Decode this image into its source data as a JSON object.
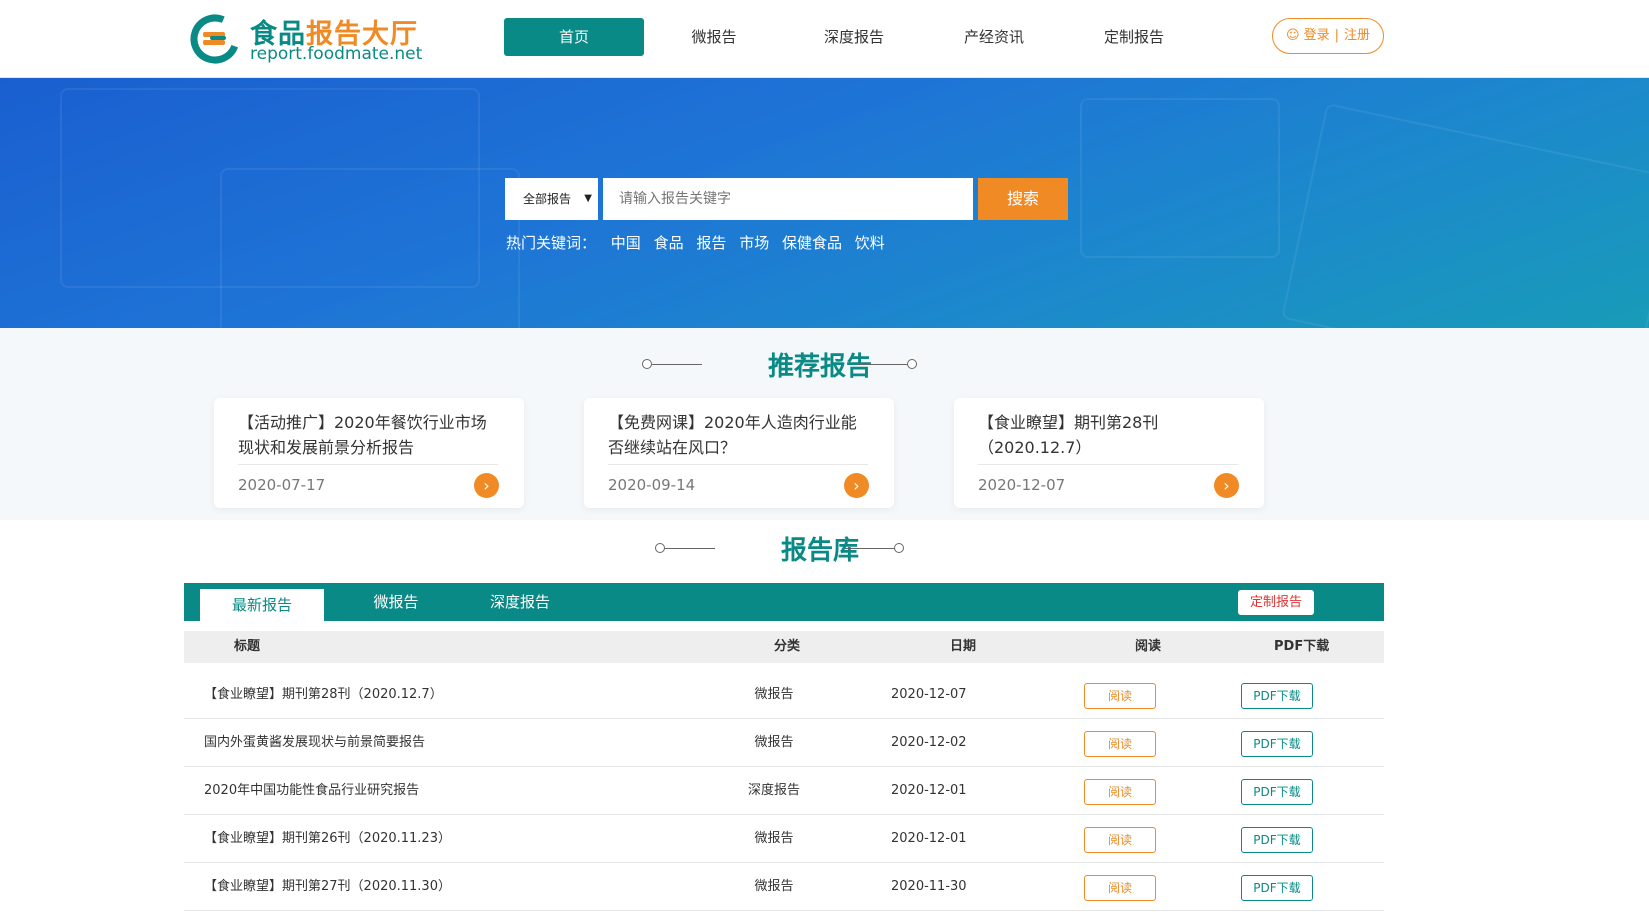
{
  "header": {
    "logo_title_part1": "食品",
    "logo_title_part2": "报告大厅",
    "logo_url": "report.foodmate.net",
    "nav": [
      {
        "label": "首页",
        "active": true
      },
      {
        "label": "微报告",
        "active": false
      },
      {
        "label": "深度报告",
        "active": false
      },
      {
        "label": "产经资讯",
        "active": false
      },
      {
        "label": "定制报告",
        "active": false
      }
    ],
    "login_label": "登录",
    "register_label": "注册"
  },
  "search": {
    "scope_label": "全部报告",
    "placeholder": "请输入报告关键字",
    "button_label": "搜索",
    "hot_label": "热门关键词：",
    "hot_keywords": [
      "中国",
      "食品",
      "报告",
      "市场",
      "保健食品",
      "饮料"
    ]
  },
  "recommend": {
    "title": "推荐报告",
    "cards": [
      {
        "title": "【活动推广】2020年餐饮行业市场现状和发展前景分析报告",
        "date": "2020-07-17"
      },
      {
        "title": "【免费网课】2020年人造肉行业能否继续站在风口？",
        "date": "2020-09-14"
      },
      {
        "title": "【食业瞭望】期刊第28刊（2020.12.7）",
        "date": "2020-12-07"
      }
    ]
  },
  "library": {
    "title": "报告库",
    "tabs": [
      {
        "label": "最新报告",
        "active": true
      },
      {
        "label": "微报告",
        "active": false
      },
      {
        "label": "深度报告",
        "active": false
      }
    ],
    "custom_button": "定制报告",
    "columns": {
      "title": "标题",
      "category": "分类",
      "date": "日期",
      "read": "阅读",
      "pdf": "PDF下载"
    },
    "rows": [
      {
        "title": "【食业瞭望】期刊第28刊（2020.12.7）",
        "category": "微报告",
        "date": "2020-12-07",
        "read": "阅读",
        "pdf": "PDF下载"
      },
      {
        "title": "国内外蛋黄酱发展现状与前景简要报告",
        "category": "微报告",
        "date": "2020-12-02",
        "read": "阅读",
        "pdf": "PDF下载"
      },
      {
        "title": "2020年中国功能性食品行业研究报告",
        "category": "深度报告",
        "date": "2020-12-01",
        "read": "阅读",
        "pdf": "PDF下载"
      },
      {
        "title": "【食业瞭望】期刊第26刊（2020.11.23）",
        "category": "微报告",
        "date": "2020-12-01",
        "read": "阅读",
        "pdf": "PDF下载"
      },
      {
        "title": "【食业瞭望】期刊第27刊（2020.11.30）",
        "category": "微报告",
        "date": "2020-11-30",
        "read": "阅读",
        "pdf": "PDF下载"
      }
    ]
  },
  "colors": {
    "brand_teal": "#0a8a86",
    "accent_orange": "#f08a24",
    "custom_red": "#e03434",
    "banner_blue": "#1e74d6"
  }
}
